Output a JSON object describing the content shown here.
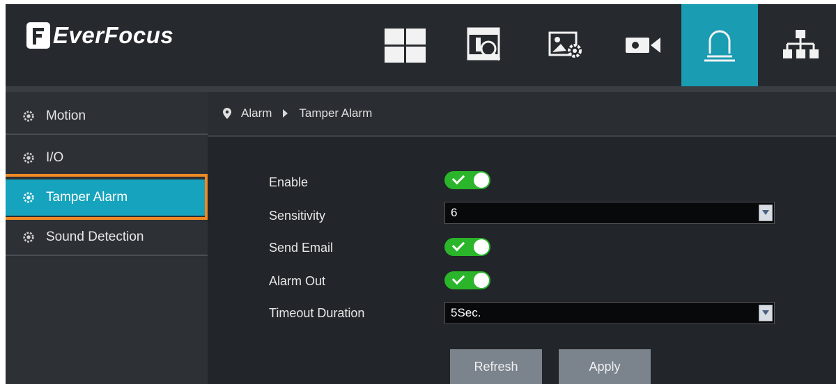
{
  "app": {
    "logo_text": "EverFocus"
  },
  "header": {
    "nav": [
      {
        "icon": "live-view-grid-icon",
        "active": false
      },
      {
        "icon": "playback-search-icon",
        "active": false
      },
      {
        "icon": "image-settings-icon",
        "active": false
      },
      {
        "icon": "camera-icon",
        "active": false
      },
      {
        "icon": "alarm-siren-icon",
        "active": true
      },
      {
        "icon": "network-icon",
        "active": false
      }
    ],
    "active_color": "#1a9cb3"
  },
  "sidebar": {
    "items": [
      {
        "label": "Motion",
        "icon": "gear-icon",
        "active": false
      },
      {
        "label": "I/O",
        "icon": "gear-icon",
        "active": false
      },
      {
        "label": "Tamper Alarm",
        "icon": "gear-icon",
        "active": true
      },
      {
        "label": "Sound Detection",
        "icon": "gear-icon",
        "active": false
      }
    ],
    "highlight_color": "#f08a24"
  },
  "breadcrumb": {
    "items": [
      "Alarm",
      "Tamper Alarm"
    ]
  },
  "form": {
    "enable": {
      "label": "Enable",
      "value": true
    },
    "sensitivity": {
      "label": "Sensitivity",
      "value": "6"
    },
    "send_email": {
      "label": "Send Email",
      "value": true
    },
    "alarm_out": {
      "label": "Alarm Out",
      "value": true
    },
    "timeout_duration": {
      "label": "Timeout Duration",
      "value": "5Sec."
    }
  },
  "buttons": {
    "refresh": "Refresh",
    "apply": "Apply"
  },
  "colors": {
    "toggle_on": "#2ab52a",
    "sidebar_active": "#16a3bd"
  }
}
